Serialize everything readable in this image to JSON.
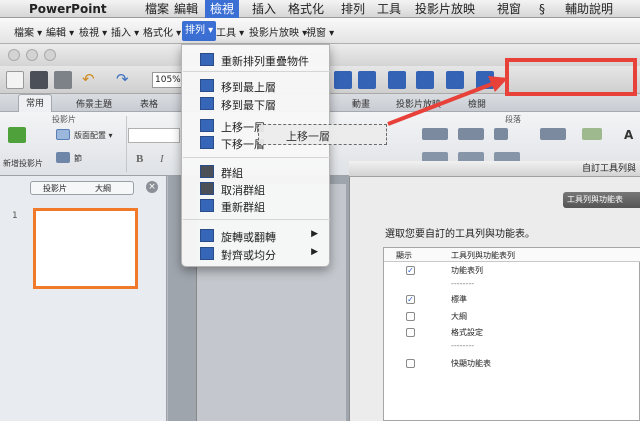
{
  "menubar": {
    "app": "PowerPoint",
    "items": [
      "檔案",
      "編輯",
      "檢視",
      "插入",
      "格式化",
      "排列",
      "工具",
      "投影片放映",
      "視窗",
      "輔助說明"
    ],
    "active_index": 2
  },
  "custom_menubar": {
    "items": [
      "檔案 ▾",
      "編輯 ▾",
      "檢視 ▾",
      "插入 ▾",
      "格式化 ▾",
      "排列 ▾",
      "工具 ▾",
      "投影片放映 ▾",
      "視窗 ▾"
    ],
    "active_index": 5
  },
  "toolbar": {
    "zoom": "105%"
  },
  "ribbon": {
    "tabs": [
      "常用",
      "佈景主題",
      "表格",
      "動畫",
      "投影片放映",
      "檢閱"
    ],
    "groups": [
      "投影片",
      "段落"
    ],
    "new_slide": "新增投影片",
    "layout": "版面配置 ▾",
    "section": "節",
    "bold": "B",
    "italic": "I",
    "text_label": "A"
  },
  "slide_panel": {
    "tabs": [
      "投影片",
      "大綱"
    ],
    "slide_number": "1"
  },
  "dropdown": {
    "items": [
      {
        "label": "重新排列重疊物件",
        "icon": "reorder-objects-icon"
      },
      {
        "label": "移到最上層",
        "icon": "bring-to-front-icon"
      },
      {
        "label": "移到最下層",
        "icon": "send-to-back-icon"
      },
      {
        "label": "上移一層",
        "icon": "bring-forward-icon"
      },
      {
        "label": "下移一層",
        "icon": "send-backward-icon"
      },
      {
        "label": "群組",
        "icon": "group-icon"
      },
      {
        "label": "取消群組",
        "icon": "ungroup-icon"
      },
      {
        "label": "重新群組",
        "icon": "regroup-icon"
      },
      {
        "label": "旋轉或翻轉",
        "icon": "rotate-icon",
        "submenu": "▶"
      },
      {
        "label": "對齊或均分",
        "icon": "align-icon",
        "submenu": "▶"
      }
    ]
  },
  "drag_ghost": {
    "label": "上移一層"
  },
  "dialog": {
    "title": "自訂工具列與",
    "tab": "工具列與功能表",
    "prompt": "選取您要自訂的工具列與功能表。",
    "columns": [
      "顯示",
      "工具列與功能表列"
    ],
    "rows": [
      {
        "label": "功能表列",
        "checked": true
      },
      {
        "label": "--------",
        "separator": true
      },
      {
        "label": "標準",
        "checked": true
      },
      {
        "label": "大綱",
        "checked": false
      },
      {
        "label": "格式設定",
        "checked": false
      },
      {
        "label": "--------",
        "separator": true
      },
      {
        "label": "快顯功能表",
        "checked": false
      }
    ]
  },
  "colors": {
    "menu_highlight": "#3b6fd4",
    "annotation_red": "#e8413a",
    "slide_border": "#f07a2a"
  }
}
